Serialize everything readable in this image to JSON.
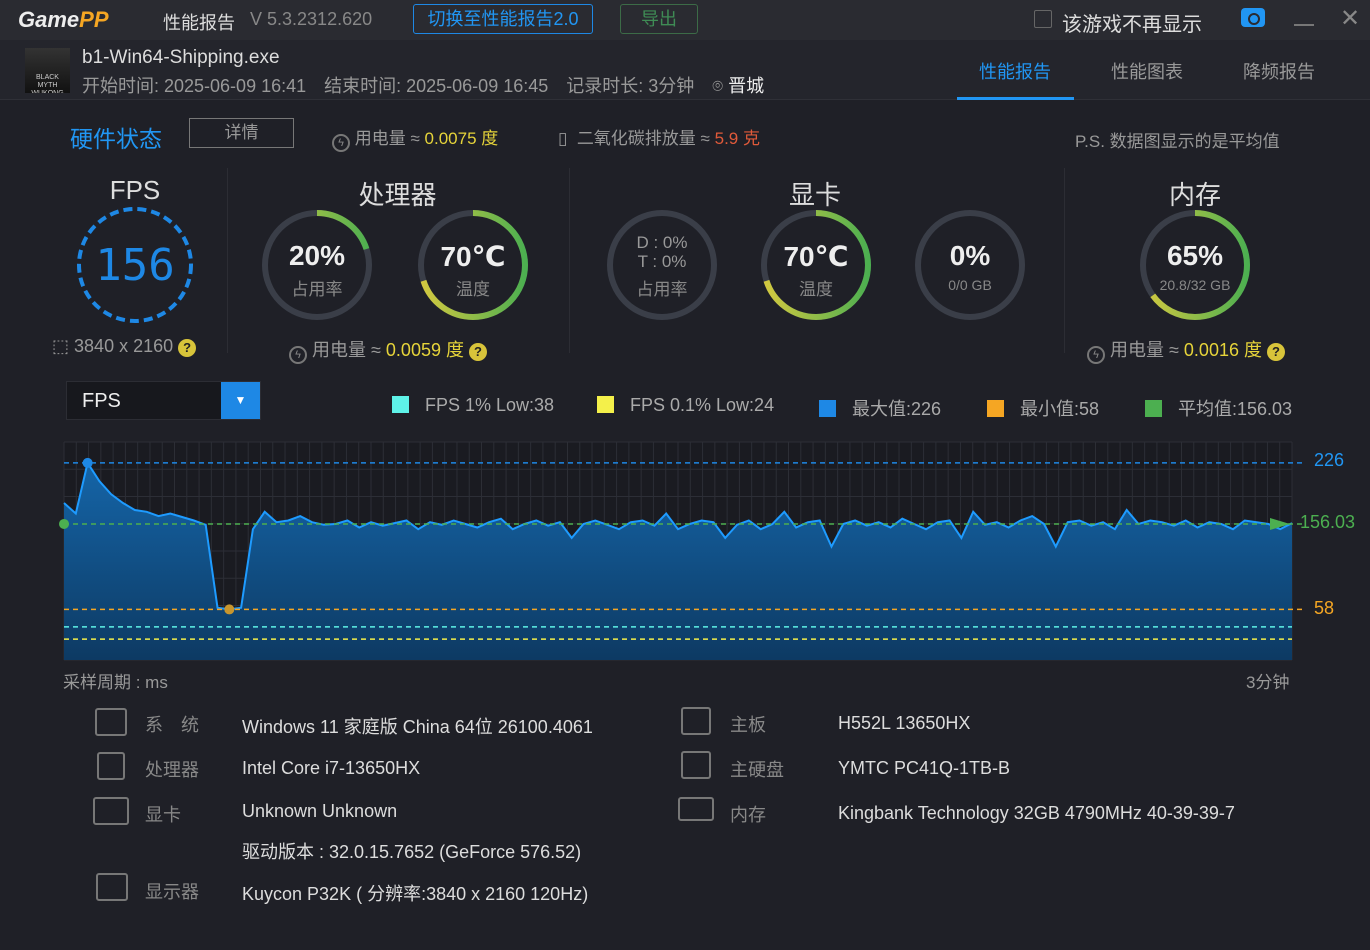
{
  "titlebar": {
    "logo": "GamePP",
    "title": "性能报告",
    "version": "V 5.3.2312.620",
    "switch_button": "切换至性能报告2.0",
    "export_button": "导出",
    "dont_show": "该游戏不再显示"
  },
  "game": {
    "icon_text": "BLACK MYTH WUKONG",
    "exe": "b1-Win64-Shipping.exe",
    "start": "开始时间: 2025-06-09 16:41",
    "end": "结束时间: 2025-06-09 16:45",
    "duration": "记录时长: 3分钟",
    "city": "晋城"
  },
  "tabs": [
    "性能报告",
    "性能图表",
    "降频报告"
  ],
  "hardware": {
    "title": "硬件状态",
    "detail_button": "详情",
    "power_label": "用电量 ≈",
    "power_value": "0.0075 度",
    "co2_label": "二氧化碳排放量 ≈",
    "co2_value": "5.9 克",
    "note": "P.S. 数据图显示的是平均值"
  },
  "fps": {
    "title": "FPS",
    "value": "156",
    "resolution": "3840 x 2160"
  },
  "cpu": {
    "title": "处理器",
    "usage": "20%",
    "usage_label": "占用率",
    "usage_frac": 0.2,
    "temp": "70℃",
    "temp_label": "温度",
    "temp_frac": 0.7,
    "power_label": "用电量 ≈",
    "power_value": "0.0059 度"
  },
  "gpu": {
    "title": "显卡",
    "usage_d": "D : 0%",
    "usage_t": "T : 0%",
    "usage_label": "占用率",
    "temp": "70℃",
    "temp_label": "温度",
    "temp_frac": 0.7,
    "vram": "0%",
    "vram_label": "0/0 GB"
  },
  "mem": {
    "title": "内存",
    "usage": "65%",
    "usage_label": "20.8/32 GB",
    "usage_frac": 0.65,
    "power_label": "用电量 ≈",
    "power_value": "0.0016 度"
  },
  "chart_controls": {
    "metric": "FPS"
  },
  "colors": {
    "low1": "#5ef2e8",
    "low01": "#f4f04a",
    "max": "#1e88e5",
    "min": "#f5a623",
    "avg": "#4caf50"
  },
  "chart_data": {
    "type": "area",
    "title": "FPS",
    "xlabel": "采样周期 : ms",
    "x_end_label": "3分钟",
    "ylim": [
      0,
      250
    ],
    "legend": [
      "FPS 1% Low:38",
      "FPS 0.1% Low:24",
      "最大值:226",
      "最小值:58",
      "平均值:156.03"
    ],
    "lines": {
      "max": 226,
      "avg": 156.03,
      "min": 58,
      "low1": 38,
      "low01": 24
    },
    "line_labels": {
      "max": "226",
      "avg": "156.03",
      "min": "58"
    },
    "values": [
      180,
      168,
      226,
      205,
      190,
      180,
      172,
      170,
      165,
      168,
      164,
      160,
      155,
      60,
      58,
      60,
      150,
      170,
      158,
      160,
      165,
      158,
      155,
      156,
      160,
      152,
      158,
      154,
      157,
      160,
      150,
      158,
      155,
      160,
      156,
      152,
      158,
      162,
      150,
      156,
      160,
      154,
      158,
      140,
      156,
      160,
      155,
      150,
      158,
      160,
      154,
      168,
      150,
      156,
      160,
      158,
      140,
      155,
      160,
      150,
      156,
      170,
      152,
      158,
      160,
      130,
      156,
      160,
      154,
      158,
      152,
      162,
      156,
      150,
      158,
      160,
      140,
      170,
      155,
      158,
      152,
      160,
      165,
      156,
      130,
      158,
      160,
      154,
      158,
      150,
      172,
      156,
      160,
      158,
      154,
      160,
      152,
      158,
      156,
      150,
      160,
      158,
      156,
      150,
      157
    ]
  },
  "sysinfo": {
    "left": [
      {
        "label": "系　统",
        "value": "Windows 11 家庭版 China 64位 26100.4061"
      },
      {
        "label": "处理器",
        "value": "Intel Core i7-13650HX"
      },
      {
        "label": "显卡",
        "value": "Unknown Unknown",
        "extra": "驱动版本 : 32.0.15.7652 (GeForce 576.52)"
      },
      {
        "label": "显示器",
        "value": "Kuycon P32K ( 分辨率:3840 x 2160 120Hz)"
      }
    ],
    "right": [
      {
        "label": "主板",
        "value": "H552L 13650HX"
      },
      {
        "label": "主硬盘",
        "value": "YMTC PC41Q-1TB-B"
      },
      {
        "label": "内存",
        "value": "Kingbank Technology 32GB 4790MHz 40-39-39-7"
      }
    ]
  }
}
